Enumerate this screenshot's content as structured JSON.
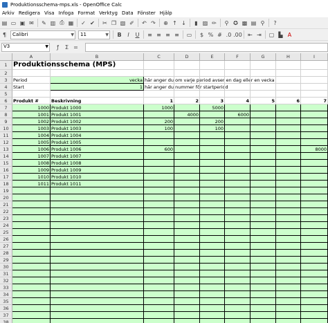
{
  "window": {
    "title": "Produktionsschema-mps.xls - OpenOffice Calc"
  },
  "menu": [
    "Arkiv",
    "Redigera",
    "Visa",
    "Infoga",
    "Format",
    "Verktyg",
    "Data",
    "Fönster",
    "Hjälp"
  ],
  "format_bar": {
    "font_name": "Calibri",
    "font_size": "11"
  },
  "formula_bar": {
    "cell_ref": "V3",
    "formula": ""
  },
  "colors": {
    "green_fill": "#ccffcc",
    "header_bg": "#e8e8e8"
  },
  "columns": [
    "A",
    "B",
    "C",
    "D",
    "E",
    "F",
    "G",
    "H",
    "I"
  ],
  "sheet": {
    "title": "Produktionsschema (MPS)",
    "period_label": "Period",
    "period_value": "vecka",
    "period_hint": "här anger du om varje period avser en dag eller en vecka",
    "start_label": "Start",
    "start_value": "1",
    "start_hint": "här anger du nummer för startperiod",
    "header_product_no": "Produkt #",
    "header_description": "Beskrivning",
    "period_numbers": [
      "1",
      "2",
      "3",
      "4",
      "5",
      "6",
      "7"
    ],
    "products": [
      {
        "id": "1000",
        "name": "Produkt 1000",
        "c": "1000",
        "d": "",
        "e": "5000",
        "f": "",
        "i": ""
      },
      {
        "id": "1001",
        "name": "Produkt 1001",
        "c": "",
        "d": "4000",
        "e": "",
        "f": "6000",
        "i": ""
      },
      {
        "id": "1002",
        "name": "Produkt 1002",
        "c": "200",
        "d": "",
        "e": "200",
        "f": "",
        "i": ""
      },
      {
        "id": "1003",
        "name": "Produkt 1003",
        "c": "100",
        "d": "",
        "e": "100",
        "f": "",
        "i": ""
      },
      {
        "id": "1004",
        "name": "Produkt 1004",
        "c": "",
        "d": "",
        "e": "",
        "f": "",
        "i": ""
      },
      {
        "id": "1005",
        "name": "Produkt 1005",
        "c": "",
        "d": "",
        "e": "",
        "f": "",
        "i": ""
      },
      {
        "id": "1006",
        "name": "Produkt 1006",
        "c": "600",
        "d": "",
        "e": "",
        "f": "",
        "i": "8000"
      },
      {
        "id": "1007",
        "name": "Produkt 1007",
        "c": "",
        "d": "",
        "e": "",
        "f": "",
        "i": ""
      },
      {
        "id": "1008",
        "name": "Produkt 1008",
        "c": "",
        "d": "",
        "e": "",
        "f": "",
        "i": ""
      },
      {
        "id": "1009",
        "name": "Produkt 1009",
        "c": "",
        "d": "",
        "e": "",
        "f": "",
        "i": ""
      },
      {
        "id": "1010",
        "name": "Produkt 1010",
        "c": "",
        "d": "",
        "e": "",
        "f": "",
        "i": ""
      },
      {
        "id": "1011",
        "name": "Produkt 1011",
        "c": "",
        "d": "",
        "e": "",
        "f": "",
        "i": ""
      }
    ],
    "row_count": 38
  }
}
